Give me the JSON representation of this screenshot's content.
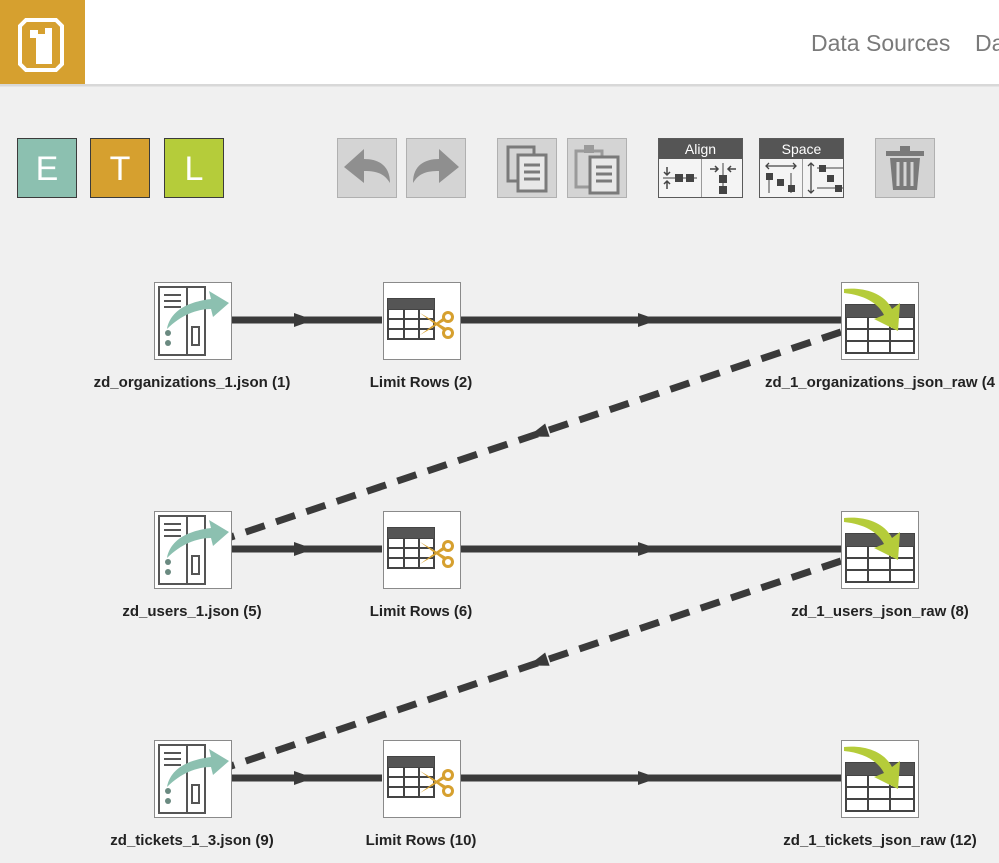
{
  "header": {
    "logo_icon": "app-logo",
    "nav": [
      "Data Sources",
      "Da"
    ]
  },
  "toolbar": {
    "etl": [
      "E",
      "T",
      "L"
    ],
    "etl_colors": [
      "#8cc0b0",
      "#d6a02f",
      "#b5cc3a"
    ],
    "align_label": "Align",
    "space_label": "Space"
  },
  "flows": [
    {
      "source": "zd_organizations_1.json (1)",
      "transform": "Limit Rows (2)",
      "target": "zd_1_organizations_json_raw (4"
    },
    {
      "source": "zd_users_1.json (5)",
      "transform": "Limit Rows (6)",
      "target": "zd_1_users_json_raw (8)"
    },
    {
      "source": "zd_tickets_1_3.json (9)",
      "transform": "Limit Rows (10)",
      "target": "zd_1_tickets_json_raw (12)"
    }
  ]
}
